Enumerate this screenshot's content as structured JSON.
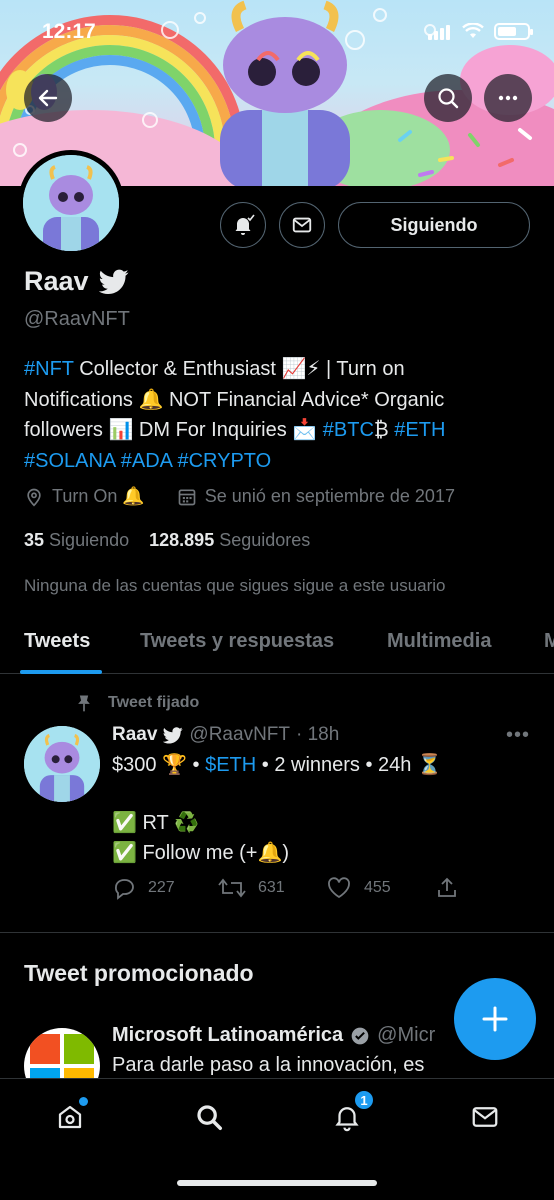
{
  "status_bar": {
    "time": "12:17"
  },
  "profile": {
    "name": "Raav",
    "handle": "@RaavNFT",
    "follow_button": "Siguiendo",
    "bio": {
      "line1_tag": "#NFT",
      "line1_text": " Collector & Enthusiast 📈⚡ | Turn on",
      "line2_text": "Notifications 🔔 NOT Financial Advice* Organic",
      "line3_text": "followers 📊 DM For Inquiries 📩 ",
      "line3_tag1": "#BTC",
      "line3_mid": "₿ ",
      "line3_tag2": "#ETH",
      "line4_tag1": "#SOLANA",
      "line4_tag2": "#ADA",
      "line4_tag3": "#CRYPTO"
    },
    "location": "Turn On 🔔",
    "joined": "Se unió en septiembre de 2017",
    "following_count": "35",
    "following_label": "Siguiendo",
    "followers_count": "128.895",
    "followers_label": "Seguidores",
    "mutuals_note": "Ninguna de las cuentas que sigues sigue a este usuario"
  },
  "tabs": [
    "Tweets",
    "Tweets y respuestas",
    "Multimedia",
    "M"
  ],
  "pinned_tweet": {
    "pinned_label": "Tweet fijado",
    "name": "Raav",
    "handle": "@RaavNFT",
    "time": "· 18h",
    "line1_a": "$300 🏆 • ",
    "line1_link": "$ETH",
    "line1_b": " • 2 winners • 24h ⏳",
    "line2": "✅ RT ♻️",
    "line3": "✅ Follow me (+🔔)",
    "replies": "227",
    "retweets": "631",
    "likes": "455"
  },
  "promoted": {
    "section_title": "Tweet promocionado",
    "name": "Microsoft Latinoamérica",
    "handle": "@Micr",
    "text": "Para darle paso a la innovación, es"
  },
  "bottom_nav": {
    "notifications_badge": "1"
  },
  "colors": {
    "accent": "#1d9bf0",
    "background": "#000000",
    "text": "#e7e9ea",
    "muted": "#71767b"
  }
}
